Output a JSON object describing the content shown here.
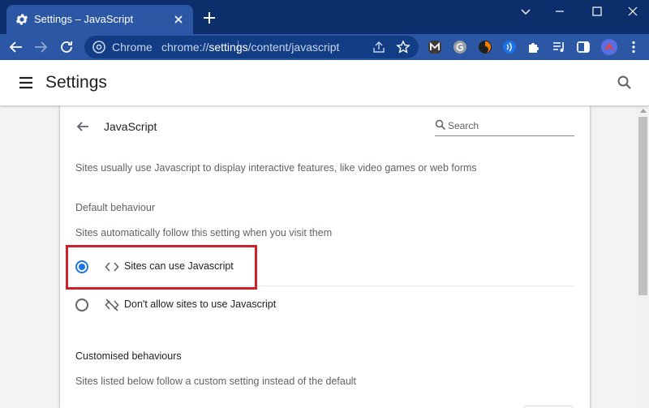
{
  "browser": {
    "tab_title": "Settings – JavaScript",
    "omnibox_chip": "Chrome",
    "url_scheme": "chrome://",
    "url_host": "settings",
    "url_path": "/content/javascript",
    "extensions": [
      "m-extension-icon",
      "grammarly-icon",
      "firefox-style-icon",
      "signal-icon",
      "puzzle-icon",
      "media-icon",
      "sidepanel-icon",
      "profile-avatar"
    ]
  },
  "header": {
    "title": "Settings"
  },
  "page": {
    "title": "JavaScript",
    "search_placeholder": "Search",
    "description": "Sites usually use Javascript to display interactive features, like video games or web forms",
    "default_heading": "Default behaviour",
    "default_sub": "Sites automatically follow this setting when you visit them",
    "options": [
      {
        "label": "Sites can use Javascript",
        "checked": true,
        "icon": "code-icon"
      },
      {
        "label": "Don't allow sites to use Javascript",
        "checked": false,
        "icon": "code-off-icon"
      }
    ],
    "custom_heading": "Customised behaviours",
    "custom_sub": "Sites listed below follow a custom setting instead of the default"
  },
  "colors": {
    "titlebar": "#0c2f6c",
    "toolbar": "#2c57a4",
    "accent": "#1a73e8",
    "highlight": "#d0202a"
  }
}
